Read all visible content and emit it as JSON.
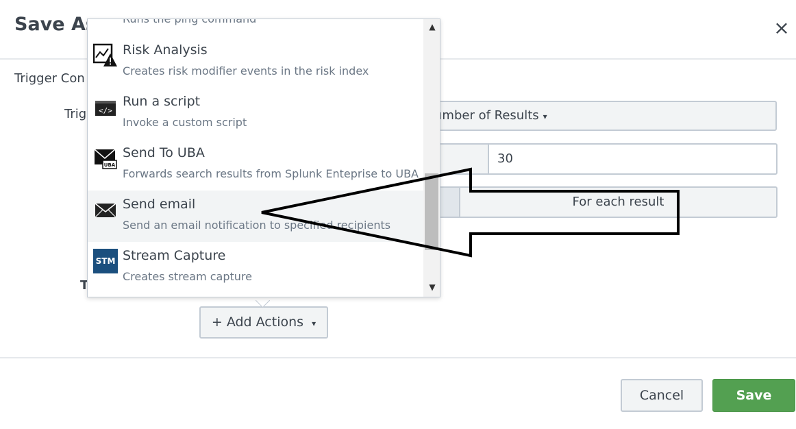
{
  "modal": {
    "title": "Save As",
    "close_glyph": "×"
  },
  "form": {
    "section_label": "Trigger Con",
    "trigger_label": "Trig",
    "t_label": "T",
    "condition_select": "umber of Results",
    "caret": "▾",
    "threshold_value": "30",
    "trigger_mode": "For each result"
  },
  "add_actions": {
    "label": "+ Add Actions",
    "caret": "▾"
  },
  "dropdown": {
    "partial_top_desc": "Runs the ping command",
    "items": [
      {
        "title": "Risk Analysis",
        "desc": "Creates risk modifier events in the risk index",
        "icon": "risk-analysis-icon"
      },
      {
        "title": "Run a script",
        "desc": "Invoke a custom script",
        "icon": "script-icon"
      },
      {
        "title": "Send To UBA",
        "desc": "Forwards search results from Splunk Enteprise to UBA",
        "icon": "uba-mail-icon",
        "icon_text": "UBA"
      },
      {
        "title": "Send email",
        "desc": "Send an email notification to specified recipients",
        "icon": "envelope-icon"
      },
      {
        "title": "Stream Capture",
        "desc": "Creates stream capture",
        "icon": "stm-icon",
        "icon_text": "STM"
      }
    ],
    "scroll_up": "▲",
    "scroll_down": "▼"
  },
  "footer": {
    "cancel_label": "Cancel",
    "save_label": "Save"
  },
  "colors": {
    "save_green": "#53a051",
    "stm_blue": "#1b4f7e",
    "text": "#3c444d"
  }
}
